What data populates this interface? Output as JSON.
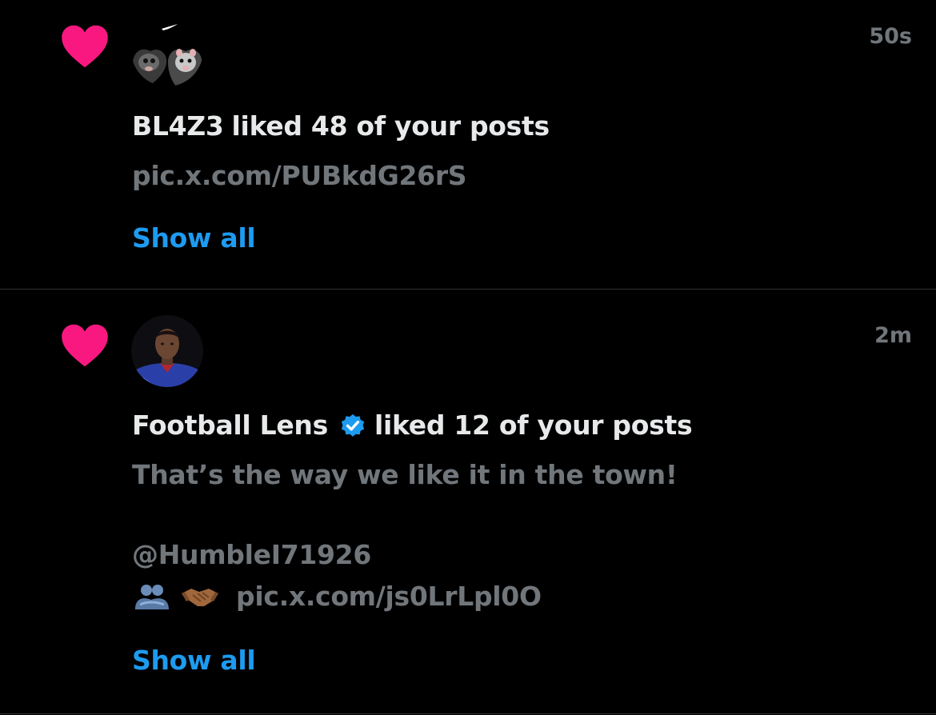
{
  "colors": {
    "background": "#000000",
    "like_heart": "#f91880",
    "primary_text": "#e7e9ea",
    "secondary_text": "#71767b",
    "link": "#1d9bf0",
    "verified_badge": "#1d9bf0",
    "divider": "#2f3336"
  },
  "notifications": [
    {
      "type_icon": "heart-icon",
      "timestamp": "50s",
      "user_name": "BL4Z3",
      "action_text": "liked 48 of your posts",
      "body": "pic.x.com/PUBkdG26rS",
      "show_all_label": "Show all"
    },
    {
      "type_icon": "heart-icon",
      "timestamp": "2m",
      "user_name": "Football Lens",
      "verified": true,
      "action_text": "liked 12 of your posts",
      "body_line1": "That’s the way we like it in the town!",
      "body_mention": "@HumbleI71926",
      "body_emojis": [
        "people-hugging-emoji",
        "handshake-emoji"
      ],
      "body_link": "pic.x.com/js0LrLpl0O",
      "show_all_label": "Show all"
    }
  ]
}
